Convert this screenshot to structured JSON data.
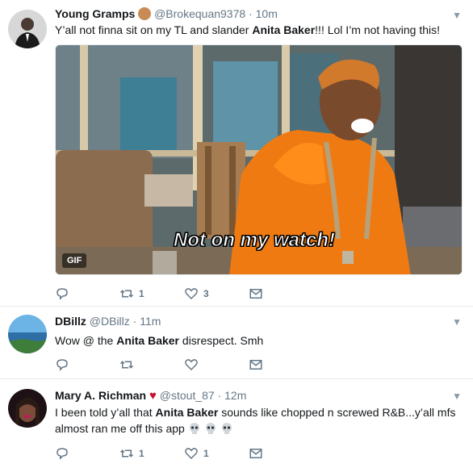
{
  "tweets": [
    {
      "name": "Young Gramps",
      "handle": "@Brokequan9378",
      "sep": "·",
      "time": "10m",
      "text_pre": "Y’all not finna sit on my TL and slander ",
      "text_bold": "Anita Baker",
      "text_post": "!!! Lol I’m not having this!",
      "media": {
        "caption": "Not on my watch!",
        "badge": "GIF"
      },
      "actions": {
        "retweets": "1",
        "likes": "3"
      }
    },
    {
      "name": "DBillz",
      "handle": "@DBillz",
      "sep": "·",
      "time": "11m",
      "text_pre": "Wow @ the ",
      "text_bold": "Anita Baker",
      "text_post": " disrespect. Smh",
      "actions": {
        "retweets": "",
        "likes": ""
      }
    },
    {
      "name": "Mary A. Richman",
      "handle": "@stout_87",
      "sep": "·",
      "time": "12m",
      "text_pre": "I been told y’all that ",
      "text_bold": "Anita Baker",
      "text_post": " sounds like chopped n screwed R&B...y’all mfs almost ran me off this app",
      "actions": {
        "retweets": "1",
        "likes": "1"
      }
    }
  ],
  "colors": {
    "icon": "#657786",
    "border": "#e6ecf0",
    "orange": "#f07a12"
  }
}
